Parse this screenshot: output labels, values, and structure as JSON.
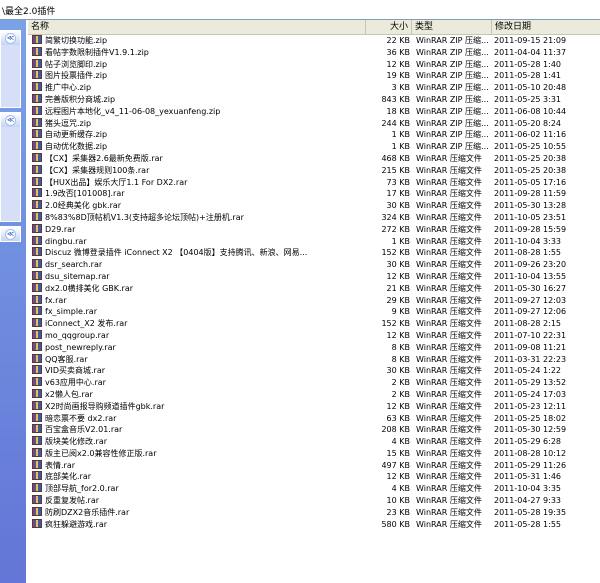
{
  "address": {
    "path": "\\最全2.0插件"
  },
  "columns": {
    "name": "名称",
    "size": "大小",
    "type": "类型",
    "date": "修改日期"
  },
  "files": [
    {
      "name": "简繁切换功能.zip",
      "size": "22 KB",
      "type": "WinRAR ZIP 压缩...",
      "date": "2011-09-15 21:09"
    },
    {
      "name": "看帖字数限制插件V1.9.1.zip",
      "size": "36 KB",
      "type": "WinRAR ZIP 压缩...",
      "date": "2011-04-04 11:37"
    },
    {
      "name": "帖子浏览脚印.zip",
      "size": "12 KB",
      "type": "WinRAR ZIP 压缩...",
      "date": "2011-05-28 1:40"
    },
    {
      "name": "图片投票插件.zip",
      "size": "19 KB",
      "type": "WinRAR ZIP 压缩...",
      "date": "2011-05-28 1:41"
    },
    {
      "name": "推广中心.zip",
      "size": "3 KB",
      "type": "WinRAR ZIP 压缩...",
      "date": "2011-05-10 20:48"
    },
    {
      "name": "完善版积分商城.zip",
      "size": "843 KB",
      "type": "WinRAR ZIP 压缩...",
      "date": "2011-05-25 3:31"
    },
    {
      "name": "远程图片本地化_v4_11-06-08_yexuanfeng.zip",
      "size": "18 KB",
      "type": "WinRAR ZIP 压缩...",
      "date": "2011-06-08 10:44"
    },
    {
      "name": "猪头逗咒.zip",
      "size": "244 KB",
      "type": "WinRAR ZIP 压缩...",
      "date": "2011-05-20 8:24"
    },
    {
      "name": "自动更新缓存.zip",
      "size": "1 KB",
      "type": "WinRAR ZIP 压缩...",
      "date": "2011-06-02 11:16"
    },
    {
      "name": "自动优化数据.zip",
      "size": "1 KB",
      "type": "WinRAR ZIP 压缩...",
      "date": "2011-05-25 10:55"
    },
    {
      "name": "【CX】采集器2.6最新免费版.rar",
      "size": "468 KB",
      "type": "WinRAR 压缩文件",
      "date": "2011-05-25 20:38"
    },
    {
      "name": "【CX】采集器规则100条.rar",
      "size": "215 KB",
      "type": "WinRAR 压缩文件",
      "date": "2011-05-25 20:38"
    },
    {
      "name": "【HUX出品】娱乐大厅1.1 For DX2.rar",
      "size": "73 KB",
      "type": "WinRAR 压缩文件",
      "date": "2011-05-05 17:16"
    },
    {
      "name": "1.9改否[101008].rar",
      "size": "17 KB",
      "type": "WinRAR 压缩文件",
      "date": "2011-09-28 11:59"
    },
    {
      "name": "2.0经典美化 gbk.rar",
      "size": "30 KB",
      "type": "WinRAR 压缩文件",
      "date": "2011-05-30 13:28"
    },
    {
      "name": "8%83%8D顶帖机V1.3(支持超多论坛顶帖)+注册机.rar",
      "size": "324 KB",
      "type": "WinRAR 压缩文件",
      "date": "2011-10-05 23:51"
    },
    {
      "name": "D29.rar",
      "size": "272 KB",
      "type": "WinRAR 压缩文件",
      "date": "2011-09-28 15:59"
    },
    {
      "name": "dingbu.rar",
      "size": "1 KB",
      "type": "WinRAR 压缩文件",
      "date": "2011-10-04 3:33"
    },
    {
      "name": "Discuz 微博登录插件 iConnect X2 【0404版】支持腾讯、新浪、网易...",
      "size": "152 KB",
      "type": "WinRAR 压缩文件",
      "date": "2011-08-28 1:55"
    },
    {
      "name": "dsr_search.rar",
      "size": "30 KB",
      "type": "WinRAR 压缩文件",
      "date": "2011-09-26 23:20"
    },
    {
      "name": "dsu_sitemap.rar",
      "size": "12 KB",
      "type": "WinRAR 压缩文件",
      "date": "2011-10-04 13:55"
    },
    {
      "name": "dx2.0横排美化 GBK.rar",
      "size": "21 KB",
      "type": "WinRAR 压缩文件",
      "date": "2011-05-30 16:27"
    },
    {
      "name": "fx.rar",
      "size": "29 KB",
      "type": "WinRAR 压缩文件",
      "date": "2011-09-27 12:03"
    },
    {
      "name": "fx_simple.rar",
      "size": "9 KB",
      "type": "WinRAR 压缩文件",
      "date": "2011-09-27 12:06"
    },
    {
      "name": "iConnect_X2 发布.rar",
      "size": "152 KB",
      "type": "WinRAR 压缩文件",
      "date": "2011-08-28 2:15"
    },
    {
      "name": "mo_qqgroup.rar",
      "size": "12 KB",
      "type": "WinRAR 压缩文件",
      "date": "2011-07-10 22:31"
    },
    {
      "name": "post_newreply.rar",
      "size": "8 KB",
      "type": "WinRAR 压缩文件",
      "date": "2011-09-08 11:21"
    },
    {
      "name": "QQ客服.rar",
      "size": "8 KB",
      "type": "WinRAR 压缩文件",
      "date": "2011-03-31 22:23"
    },
    {
      "name": "VID买卖商城.rar",
      "size": "30 KB",
      "type": "WinRAR 压缩文件",
      "date": "2011-05-24 1:22"
    },
    {
      "name": "v63应用中心.rar",
      "size": "2 KB",
      "type": "WinRAR 压缩文件",
      "date": "2011-05-29 13:52"
    },
    {
      "name": "x2懒人包.rar",
      "size": "2 KB",
      "type": "WinRAR 压缩文件",
      "date": "2011-05-24 17:03"
    },
    {
      "name": "X2时尚画报导购频道插件gbk.rar",
      "size": "12 KB",
      "type": "WinRAR 压缩文件",
      "date": "2011-05-23 12:11"
    },
    {
      "name": "暗恋票不要 dx2.rar",
      "size": "63 KB",
      "type": "WinRAR 压缩文件",
      "date": "2011-05-25 18:02"
    },
    {
      "name": "百宝盒音乐V2.01.rar",
      "size": "208 KB",
      "type": "WinRAR 压缩文件",
      "date": "2011-05-30 12:59"
    },
    {
      "name": "版块美化修改.rar",
      "size": "4 KB",
      "type": "WinRAR 压缩文件",
      "date": "2011-05-29 6:28"
    },
    {
      "name": "版主已阅x2.0兼容性修正版.rar",
      "size": "15 KB",
      "type": "WinRAR 压缩文件",
      "date": "2011-08-28 10:12"
    },
    {
      "name": "表情.rar",
      "size": "497 KB",
      "type": "WinRAR 压缩文件",
      "date": "2011-05-29 11:26"
    },
    {
      "name": "底部美化.rar",
      "size": "12 KB",
      "type": "WinRAR 压缩文件",
      "date": "2011-05-31 1:46"
    },
    {
      "name": "顶部导航_for2.0.rar",
      "size": "4 KB",
      "type": "WinRAR 压缩文件",
      "date": "2011-10-04 3:35"
    },
    {
      "name": "反重复发帖.rar",
      "size": "10 KB",
      "type": "WinRAR 压缩文件",
      "date": "2011-04-27 9:33"
    },
    {
      "name": "防刷DZX2音乐插件.rar",
      "size": "23 KB",
      "type": "WinRAR 压缩文件",
      "date": "2011-05-28 19:35"
    },
    {
      "name": "疯狂躲避游戏.rar",
      "size": "580 KB",
      "type": "WinRAR 压缩文件",
      "date": "2011-05-28 1:55"
    }
  ],
  "pane": {
    "chevron_glyph": "≪"
  }
}
